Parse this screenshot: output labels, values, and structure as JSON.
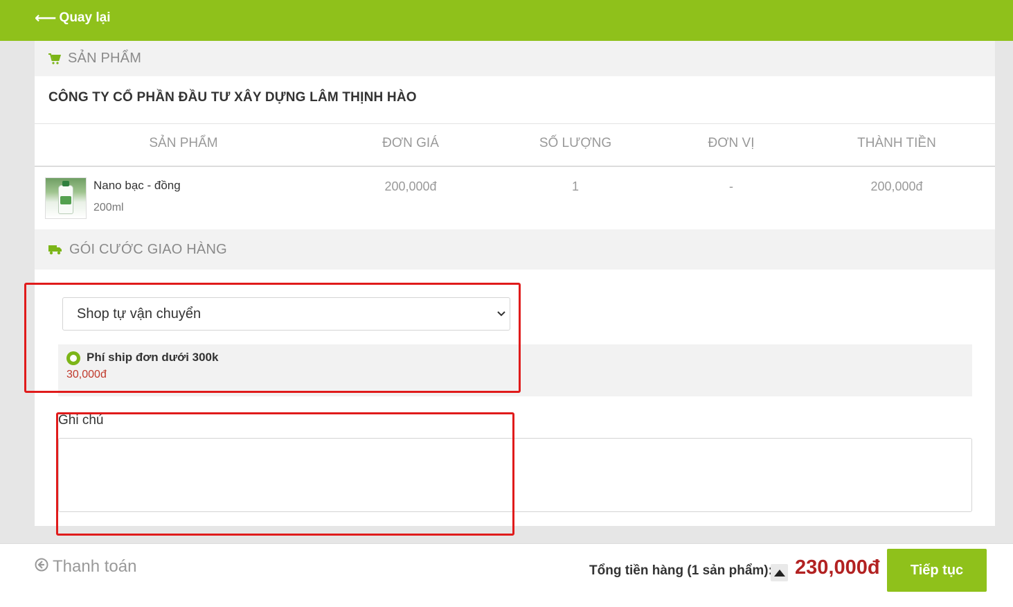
{
  "header": {
    "back_label": "Quay lại",
    "back_icon": "arrow-left-icon",
    "bg_color": "#8fc11b"
  },
  "products_section": {
    "title": "SẢN PHẨM",
    "icon": "cart-icon",
    "shop_name": "CÔNG TY CỔ PHẦN ĐẦU TƯ XÂY DỰNG LÂM THỊNH HÀO",
    "columns": [
      "SẢN PHẨM",
      "ĐƠN GIÁ",
      "SỐ LƯỢNG",
      "ĐƠN VỊ",
      "THÀNH TIỀN"
    ],
    "rows": [
      {
        "name": "Nano bạc - đồng",
        "variant": "200ml",
        "unit_price": "200,000đ",
        "quantity": "1",
        "unit": "-",
        "subtotal": "200,000đ"
      }
    ]
  },
  "shipping_section": {
    "title": "GÓI CƯỚC GIAO HÀNG",
    "icon": "truck-icon",
    "carrier_selected": "Shop tự vận chuyển",
    "option": {
      "name": "Phí ship đơn dưới 300k",
      "price": "30,000đ",
      "selected": true
    }
  },
  "note": {
    "label": "Ghi chú",
    "value": ""
  },
  "footer": {
    "title": "Thanh toán",
    "title_icon": "circle-arrow-left-icon",
    "total_label": "Tổng tiền hàng (1 sản phẩm):",
    "total_amount": "230,000đ",
    "continue_label": "Tiếp tục"
  },
  "colors": {
    "accent": "#8fc11b",
    "price_red": "#b22222",
    "annotation_red": "#e01b1b"
  }
}
